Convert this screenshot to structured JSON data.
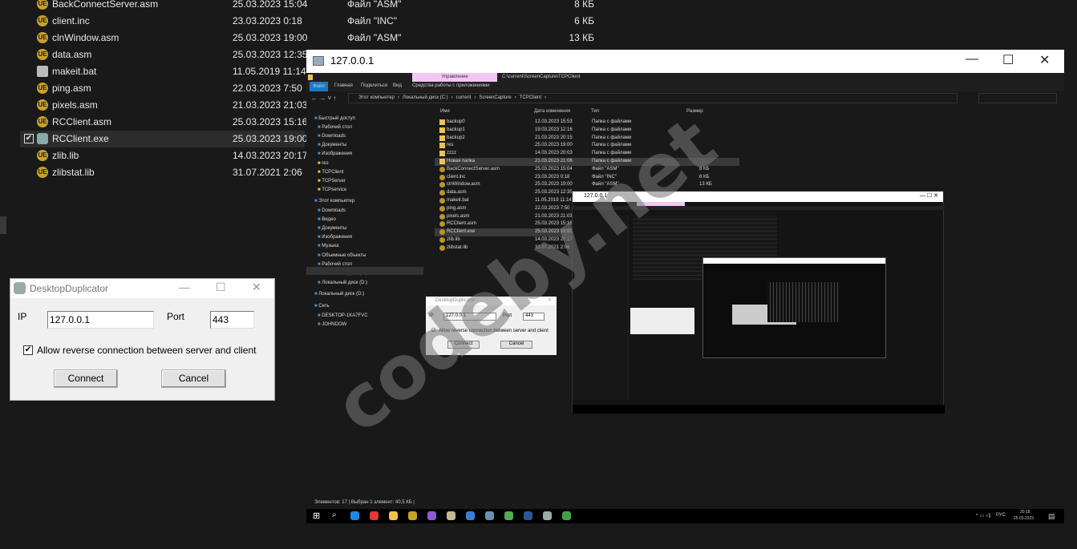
{
  "left_list": [
    {
      "name": "BackConnectServer.asm",
      "date": "25.03.2023 15:04",
      "type": "Файл \"ASM\"",
      "size": "8 КБ",
      "icon": "asm-file-icon"
    },
    {
      "name": "client.inc",
      "date": "23.03.2023 0:18",
      "type": "Файл \"INC\"",
      "size": "6 КБ",
      "icon": "asm-file-icon"
    },
    {
      "name": "clnWindow.asm",
      "date": "25.03.2023 19:00",
      "type": "Файл \"ASM\"",
      "size": "13 КБ",
      "icon": "asm-file-icon"
    },
    {
      "name": "data.asm",
      "date": "25.03.2023 12:35",
      "icon": "asm-file-icon"
    },
    {
      "name": "makeit.bat",
      "date": "11.05.2019 11:14",
      "icon": "bat-file-icon"
    },
    {
      "name": "ping.asm",
      "date": "22.03.2023 7:50",
      "icon": "asm-file-icon"
    },
    {
      "name": "pixels.asm",
      "date": "21.03.2023 21:03",
      "icon": "asm-file-icon"
    },
    {
      "name": "RCClient.asm",
      "date": "25.03.2023 15:16",
      "icon": "asm-file-icon"
    },
    {
      "name": "RCClient.exe",
      "date": "25.03.2023 19:00",
      "icon": "exe-file-icon",
      "selected": true
    },
    {
      "name": "zlib.lib",
      "date": "14.03.2023 20:17",
      "icon": "asm-file-icon"
    },
    {
      "name": "zlibstat.lib",
      "date": "31.07.2021 2:06",
      "icon": "asm-file-icon"
    }
  ],
  "dialog": {
    "title": "DesktopDuplicator",
    "ip_label": "IP",
    "ip_value": "127.0.0.1",
    "port_label": "Port",
    "port_value": "443",
    "checkbox_label": "Allow reverse connection between server and client",
    "checkbox_checked": true,
    "connect": "Connect",
    "cancel": "Cancel"
  },
  "remote": {
    "title": "127.0.0.1",
    "ribbon_context_tab": "Управление",
    "path_title": "C:\\current\\ScreenCapture\\TCPClient",
    "menu": [
      "Файл",
      "Главная",
      "Поделиться",
      "Вид",
      "Средства работы с приложениями"
    ],
    "breadcrumb": [
      "Этот компьютер",
      "Локальный диск (C:)",
      "current",
      "ScreenCapture",
      "TCPClient"
    ],
    "columns": [
      "Имя",
      "Дата изменения",
      "Тип",
      "Размер"
    ],
    "nav": [
      "Быстрый доступ",
      "Рабочий стол",
      "Downloads",
      "Документы",
      "Изображения",
      "res",
      "TCPClient",
      "TCPServer",
      "TCPservice",
      "Этот компьютер",
      "Downloads",
      "Видео",
      "Документы",
      "Изображения",
      "Музыка",
      "Объемные объекты",
      "Рабочий стол",
      "Локальный диск (C:)",
      "Локальный диск (D:)",
      "Локальный диск (D:)",
      "Сеть",
      "DESKTOP-1KA7FVC",
      "JOHNDOW"
    ],
    "files": [
      {
        "name": "backup0",
        "date": "12.03.2023 15:53",
        "type": "Папка с файлами",
        "size": "",
        "kind": "folder"
      },
      {
        "name": "backup1",
        "date": "19.03.2023 12:16",
        "type": "Папка с файлами",
        "size": "",
        "kind": "folder"
      },
      {
        "name": "backup2",
        "date": "21.03.2023 20:15",
        "type": "Папка с файлами",
        "size": "",
        "kind": "folder"
      },
      {
        "name": "res",
        "date": "25.03.2023 19:00",
        "type": "Папка с файлами",
        "size": "",
        "kind": "folder"
      },
      {
        "name": "zzzz",
        "date": "14.03.2023 20:03",
        "type": "Папка с файлами",
        "size": "",
        "kind": "folder"
      },
      {
        "name": "Новая папка",
        "date": "21.03.2023 21:06",
        "type": "Папка с файлами",
        "size": "",
        "kind": "folder",
        "selected": true
      },
      {
        "name": "BackConnectServer.asm",
        "date": "25.03.2023 15:04",
        "type": "Файл \"ASM\"",
        "size": "8 КБ",
        "kind": "file"
      },
      {
        "name": "client.inc",
        "date": "23.03.2023 0:18",
        "type": "Файл \"INC\"",
        "size": "6 КБ",
        "kind": "file"
      },
      {
        "name": "clnWindow.asm",
        "date": "25.03.2023 19:00",
        "type": "Файл \"ASM\"",
        "size": "13 КБ",
        "kind": "file"
      },
      {
        "name": "data.asm",
        "date": "25.03.2023 12:35",
        "type": "",
        "size": "",
        "kind": "file"
      },
      {
        "name": "makeit.bat",
        "date": "11.05.2019 11:14",
        "type": "",
        "size": "",
        "kind": "file"
      },
      {
        "name": "ping.asm",
        "date": "22.03.2023 7:50",
        "type": "",
        "size": "",
        "kind": "file"
      },
      {
        "name": "pixels.asm",
        "date": "21.03.2023 21:03",
        "type": "",
        "size": "",
        "kind": "file"
      },
      {
        "name": "RCClient.asm",
        "date": "25.03.2023 15:16",
        "type": "",
        "size": "",
        "kind": "file"
      },
      {
        "name": "RCClient.exe",
        "date": "25.03.2023 19:00",
        "type": "",
        "size": "",
        "kind": "file",
        "selected": true
      },
      {
        "name": "zlib.lib",
        "date": "14.03.2023 20:17",
        "type": "",
        "size": "",
        "kind": "file"
      },
      {
        "name": "zlibstat.lib",
        "date": "31.07.2021 2:06",
        "type": "",
        "size": "",
        "kind": "file"
      }
    ],
    "status": "Элементов: 17  |  Выбран 1 элемент: 40,5 КБ  |",
    "dialog": {
      "title": "DesktopDuplicator",
      "ip_label": "IP",
      "ip_value": "127.0.0.1",
      "port_label": "Port",
      "port_value": "443",
      "checkbox_label": "Allow reverse connection between server and client",
      "connect": "Connect",
      "cancel": "Cancel"
    },
    "nested_title": "127.0.0.1",
    "tray": {
      "lang": "РУС",
      "time": "20:18",
      "date": "25.03.2023"
    },
    "taskbar_colors": [
      "#1e88e5",
      "#e53935",
      "#f5c04a",
      "#c9a227",
      "#8e5ad8",
      "#c8b890",
      "#3a7bd5",
      "#6a8fb0",
      "#4caf50",
      "#2b579a",
      "#9aa",
      "#43a047"
    ]
  },
  "watermark": "codeby.net"
}
